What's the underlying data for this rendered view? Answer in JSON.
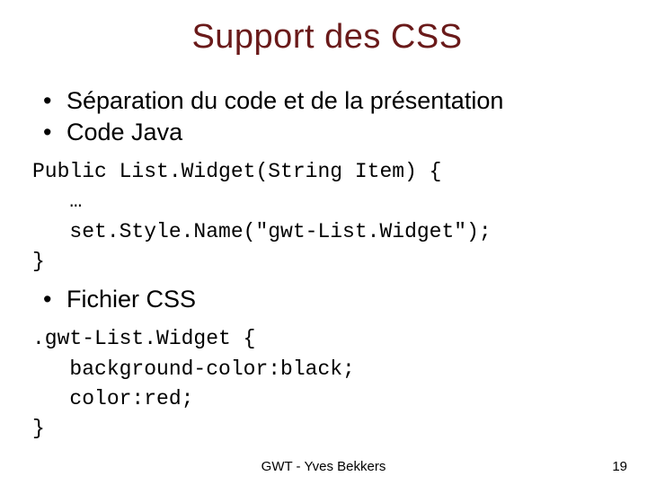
{
  "title": "Support des CSS",
  "bullets1": [
    "Séparation du code et de la présentation",
    "Code Java"
  ],
  "code1": "Public List.Widget(String Item) {\n   …\n   set.Style.Name(\"gwt-List.Widget\");\n}",
  "bullets2": [
    "Fichier CSS"
  ],
  "code2": ".gwt-List.Widget {\n   background-color:black;\n   color:red;\n}",
  "footer": "GWT - Yves Bekkers",
  "page": "19"
}
